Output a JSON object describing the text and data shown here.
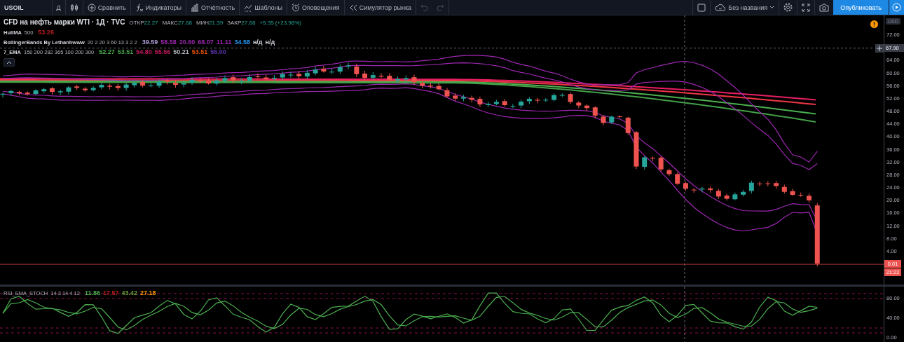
{
  "toolbar": {
    "symbol": "USOIL",
    "interval": "Д",
    "tools": [
      {
        "kind": "compare",
        "label": "Сравнить"
      },
      {
        "kind": "indicators",
        "label": "Индикаторы"
      },
      {
        "kind": "reports",
        "label": "Отчётность"
      },
      {
        "kind": "templates",
        "label": "Шаблоны"
      },
      {
        "kind": "alerts",
        "label": "Оповещения"
      },
      {
        "kind": "replay",
        "label": "Симулятор рынка"
      }
    ],
    "history": [
      {
        "kind": "undo",
        "disabled": true
      },
      {
        "kind": "redo",
        "disabled": true
      }
    ],
    "layout_name": "Без названия",
    "publish": "Опубликовать"
  },
  "legend": {
    "title": "CFD на нефть марки WTI · 1Д · TVC",
    "ohlc": [
      {
        "label": "ОТКР",
        "value": "22.27"
      },
      {
        "label": "МАКС",
        "value": "27.68"
      },
      {
        "label": "МИН",
        "value": "21.39"
      },
      {
        "label": "ЗАКР",
        "value": "27.68"
      }
    ],
    "change": "+5.35 (+23.96%)",
    "indicators": [
      {
        "name": "HullMA",
        "params": "500",
        "values": [
          {
            "text": "53.26",
            "color": "#b71c1c"
          }
        ]
      },
      {
        "name": "BollingerBands By Lethanhwww",
        "params": "20 2 20 3 60 13 3 2 2",
        "values": [
          {
            "text": "39.59",
            "color": "#b39ddb"
          },
          {
            "text": "58.58",
            "color": "#9c27b0"
          },
          {
            "text": "20.60",
            "color": "#9c27b0"
          },
          {
            "text": "68.07",
            "color": "#9c27b0"
          },
          {
            "text": "11.11",
            "color": "#9c27b0"
          },
          {
            "text": "34.58",
            "color": "#2196f3"
          },
          {
            "text": "н/д",
            "color": "#d1d4dc"
          },
          {
            "text": "н/д",
            "color": "#d1d4dc"
          }
        ]
      },
      {
        "name": "7_EMA",
        "params": "150 200 282 365 100 200 300",
        "values": [
          {
            "text": "52.27",
            "color": "#4caf50"
          },
          {
            "text": "53.51",
            "color": "#43a047"
          },
          {
            "text": "54.80",
            "color": "#c2185b"
          },
          {
            "text": "55.56",
            "color": "#c2185b"
          },
          {
            "text": "50.21",
            "color": "#b2b5be"
          },
          {
            "text": "53.51",
            "color": "#e65100"
          },
          {
            "text": "55.00",
            "color": "#5e35b1"
          }
        ]
      }
    ]
  },
  "price_axis": {
    "currency": "USD",
    "ticks": [
      "72.00",
      "64.00",
      "60.00",
      "56.00",
      "52.00",
      "48.00",
      "44.00",
      "40.00",
      "36.00",
      "32.00",
      "28.00",
      "24.00",
      "20.00",
      "16.00",
      "12.00",
      "8.00",
      "4.00"
    ],
    "crosshair_price": "67.90",
    "last_price": "0.01",
    "countdown": "21:22"
  },
  "oscillator": {
    "name": "RSI_EMA_STOCH",
    "params": "14 3 14 4 12",
    "values": [
      {
        "text": "11.86",
        "color": "#4caf50"
      },
      {
        "text": "17.57",
        "color": "#b71c1c"
      },
      {
        "text": "43.42",
        "color": "#689f38"
      },
      {
        "text": "27.18",
        "color": "#ff9800"
      }
    ],
    "ticks": [
      "80.00",
      "40.00",
      "0.00"
    ]
  }
}
